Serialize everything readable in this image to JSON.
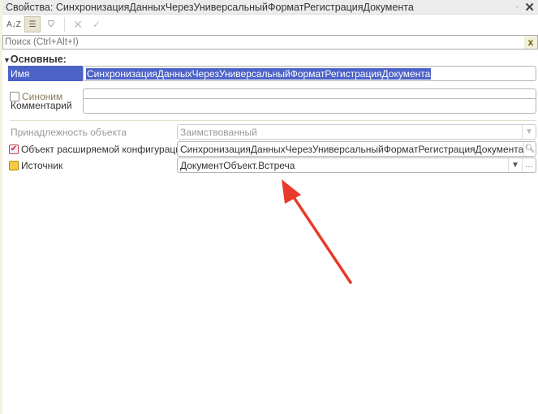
{
  "window": {
    "title": "Свойства: СинхронизацияДанныхЧерезУниверсальныйФорматРегистрацияДокумента",
    "close": "✕",
    "pin": "⬞"
  },
  "toolbar": {
    "sort": "A↓Z",
    "categories": "☰",
    "filter": "⛉",
    "cancel": "✕",
    "ok": "✓"
  },
  "search": {
    "placeholder": "Поиск (Ctrl+Alt+I)",
    "clear": "x"
  },
  "group": {
    "label": "Основные:"
  },
  "props": {
    "name_label": "Имя",
    "name_value": "СинхронизацияДанныхЧерезУниверсальныйФорматРегистрацияДокумента",
    "synonym_label": "Синоним",
    "synonym_value": "",
    "comment_label": "Комментарий",
    "comment_value": "",
    "belonging_label": "Принадлежность объекта",
    "belonging_value": "Заимствованный",
    "extended_label": "Объект расширяемой конфигурации",
    "extended_value": "СинхронизацияДанныхЧерезУниверсальныйФорматРегистрацияДокумента",
    "source_label": "Источник",
    "source_value": "ДокументОбъект.Встреча"
  },
  "annotation": {
    "arrow_color": "#e8392c"
  }
}
